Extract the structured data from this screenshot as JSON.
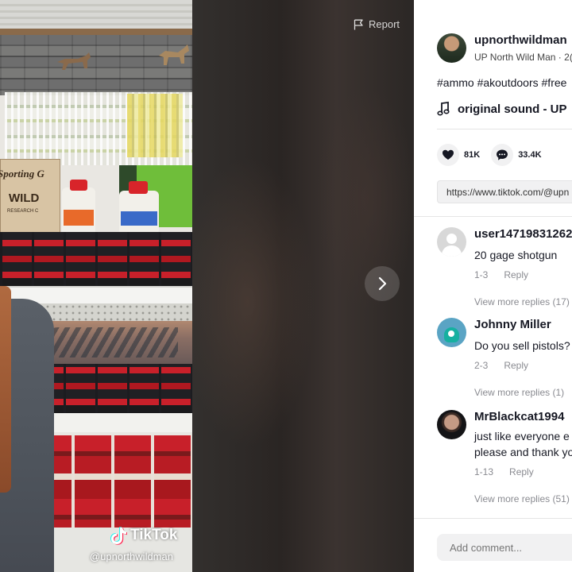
{
  "video": {
    "report_label": "Report",
    "watermark_brand": "TikTok",
    "watermark_handle": "@upnorthwildman",
    "store_box_text_1": "Sporting G",
    "store_box_text_2": "WILD",
    "store_box_text_3": "RESEARCH C"
  },
  "author": {
    "handle": "upnorthwildman",
    "subtitle": "UP North Wild Man · 2("
  },
  "description": {
    "hashtags": "#ammo #akoutdoors #free"
  },
  "sound": {
    "label": "original sound - UP"
  },
  "actions": {
    "likes": "81K",
    "comments": "33.4K"
  },
  "share": {
    "link": "https://www.tiktok.com/@upn"
  },
  "comments": [
    {
      "name": "user14719831262",
      "text": "20 gage shotgun",
      "date": "1-3",
      "reply_label": "Reply",
      "view_replies": "View more replies (17)"
    },
    {
      "name": "Johnny Miller",
      "text": "Do you sell pistols?",
      "date": "2-3",
      "reply_label": "Reply",
      "view_replies": "View more replies (1)"
    },
    {
      "name": "MrBlackcat1994",
      "text": "just like everyone e",
      "text2": "please and thank yo",
      "date": "1-13",
      "reply_label": "Reply",
      "view_replies": "View more replies (51)"
    }
  ],
  "comment_input": {
    "placeholder": "Add comment..."
  },
  "colors": {
    "panel_bg": "#ffffff",
    "text_primary": "#161823",
    "text_secondary": "#8a8b91",
    "chip_bg": "#f1f1f2"
  },
  "icons": {
    "report": "flag-icon",
    "next": "chevron-right-icon",
    "sound": "music-note-icon",
    "like": "heart-icon",
    "comment": "comment-bubble-icon",
    "brand": "tiktok-logo-icon"
  }
}
